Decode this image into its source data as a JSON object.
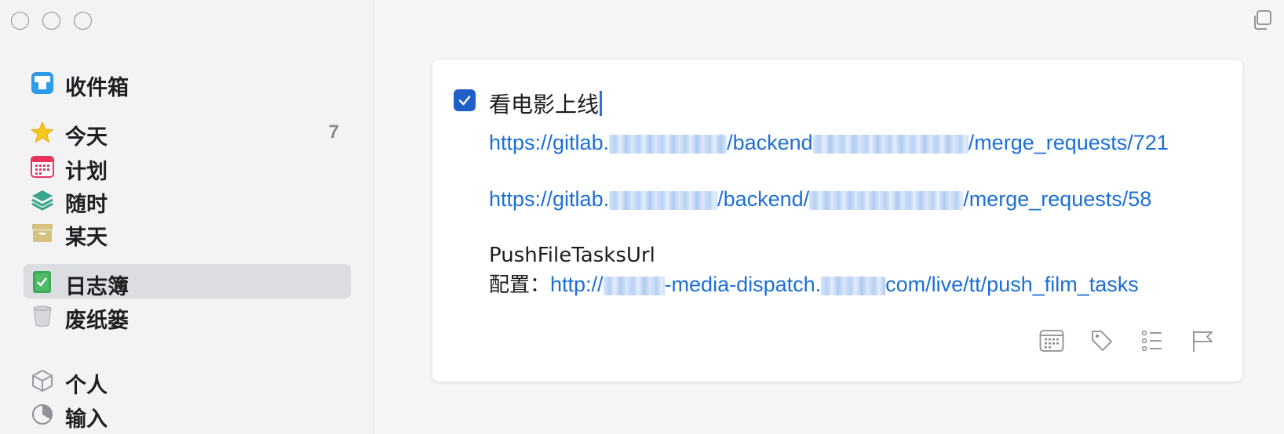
{
  "sidebar": {
    "items": [
      {
        "label": "收件箱",
        "icon": "inbox-icon",
        "count": ""
      },
      {
        "label": "今天",
        "icon": "star-icon",
        "count": "7"
      },
      {
        "label": "计划",
        "icon": "calendar-icon",
        "count": ""
      },
      {
        "label": "随时",
        "icon": "layers-icon",
        "count": ""
      },
      {
        "label": "某天",
        "icon": "archive-box-icon",
        "count": ""
      },
      {
        "label": "日志簿",
        "icon": "logbook-icon",
        "count": ""
      },
      {
        "label": "废纸篓",
        "icon": "trash-icon",
        "count": ""
      },
      {
        "label": "个人",
        "icon": "cube-icon",
        "count": ""
      },
      {
        "label": "输入",
        "icon": "pie-icon",
        "count": ""
      }
    ],
    "active_item": "日志簿"
  },
  "task": {
    "completed": true,
    "title": "看电影上线",
    "notes": {
      "link1_prefix": "https://gitlab.",
      "link1_mid": "/backend",
      "link1_suffix": "/merge_requests/721",
      "link2_prefix": "https://gitlab.",
      "link2_mid": "/backend/",
      "link2_suffix": "/merge_requests/58",
      "label": "PushFileTasksUrl",
      "config_label": "配置：",
      "link3_prefix": "http://",
      "link3_mid": "-media-dispatch.",
      "link3_suffix": "com/live/tt/push_film_tasks"
    }
  },
  "toolbar": {
    "icons": [
      "calendar-icon",
      "tag-icon",
      "checklist-icon",
      "flag-icon"
    ]
  },
  "colors": {
    "accent": "#1f5fc7",
    "link": "#1b6fd6",
    "sidebar_active": "#dcdde1"
  }
}
